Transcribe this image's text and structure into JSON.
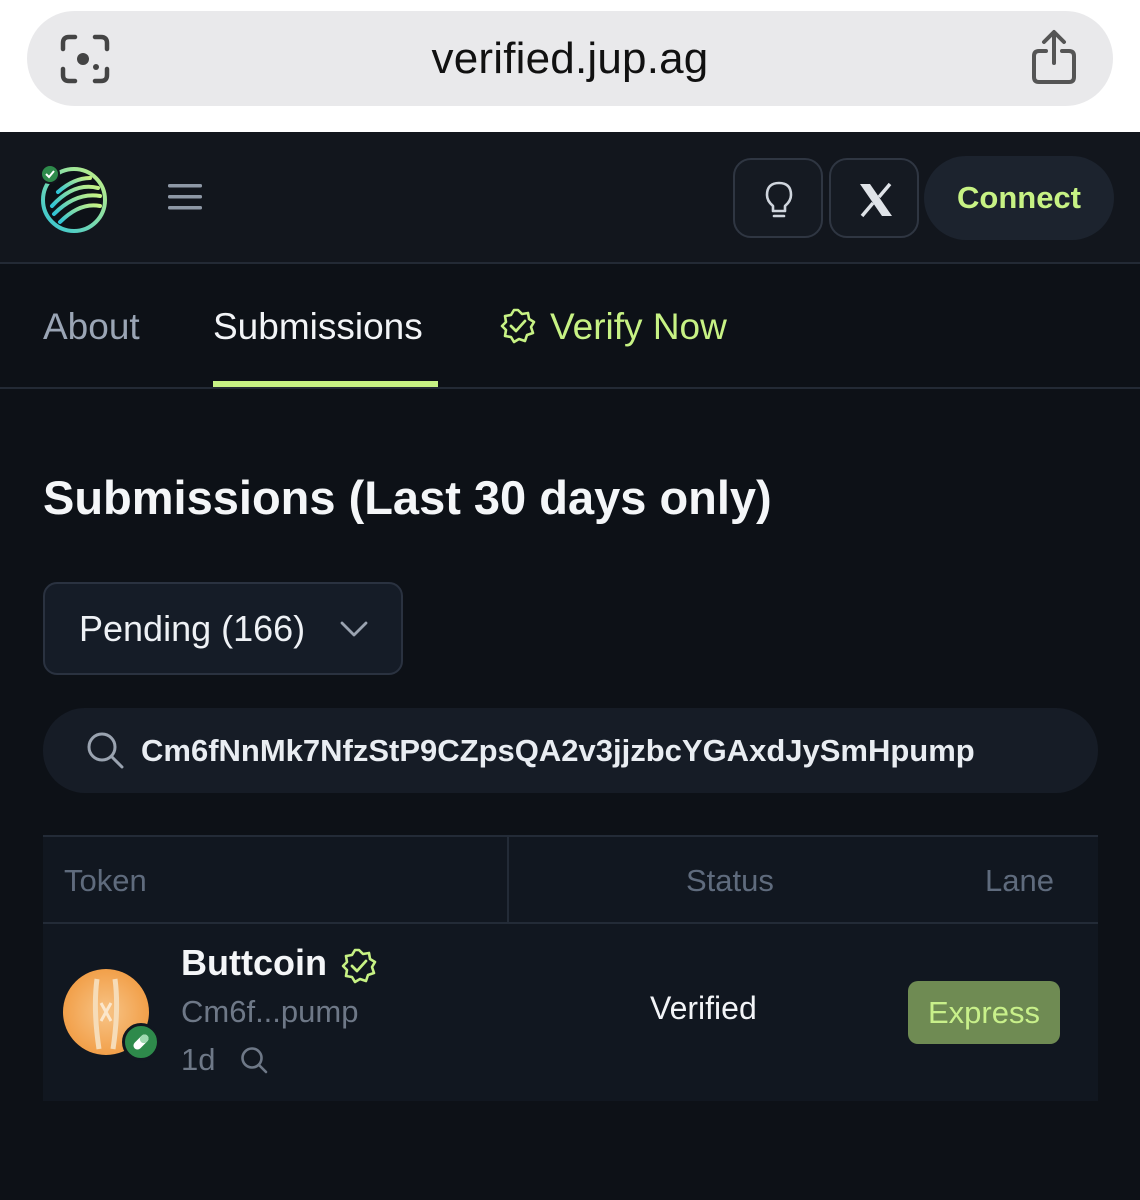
{
  "browser": {
    "url": "verified.jup.ag"
  },
  "header": {
    "connect_label": "Connect",
    "x_label": "X"
  },
  "tabs": [
    {
      "label": "About"
    },
    {
      "label": "Submissions"
    },
    {
      "label": "Verify Now"
    }
  ],
  "page": {
    "heading": "Submissions (Last 30 days only)",
    "filter": {
      "selected": "Pending (166)"
    },
    "search": {
      "value": "Cm6fNnMk7NfzStP9CZpsQA2v3jjzbcYGAxdJySmHpump"
    }
  },
  "table": {
    "columns": [
      "Token",
      "Status",
      "Lane"
    ],
    "rows": [
      {
        "name": "Buttcoin",
        "address": "Cm6f...pump",
        "age": "1d",
        "status": "Verified",
        "lane": "Express"
      }
    ]
  },
  "colors": {
    "accent": "#c7f284",
    "background": "#0d1117",
    "lane_badge": "#6f8b53"
  },
  "icons": [
    "lens-icon",
    "share-icon",
    "logo",
    "menu-icon",
    "lightbulb-icon",
    "x-icon",
    "verified-check-icon",
    "chevron-down-icon",
    "search-icon",
    "pill-icon"
  ]
}
